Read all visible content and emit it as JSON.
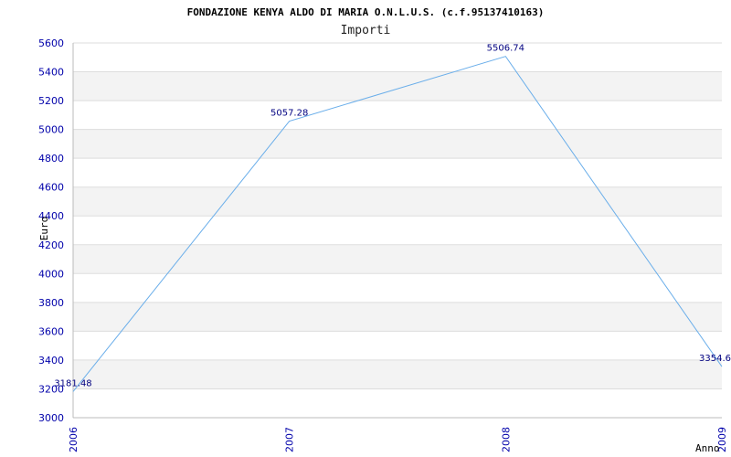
{
  "colors": {
    "line": "#6aaeea",
    "tick_text": "#0000aa",
    "data_label": "#000080",
    "band": "#f3f3f3",
    "grid": "#dddddd",
    "axis": "#bbbbbb"
  },
  "chart_data": {
    "type": "line",
    "title": "FONDAZIONE KENYA ALDO DI MARIA O.N.L.U.S. (c.f.95137410163)",
    "subtitle": "Importi",
    "xlabel": "Anno",
    "ylabel": "Euro",
    "categories": [
      "2006",
      "2007",
      "2008",
      "2009"
    ],
    "series": [
      {
        "values": [
          3181.48,
          5057.28,
          5506.74,
          3354.6
        ],
        "labels": [
          "3181.48",
          "5057.28",
          "5506.74",
          "3354.6"
        ]
      }
    ],
    "ylim": [
      3000,
      5600
    ],
    "yticks": [
      3000,
      3200,
      3400,
      3600,
      3800,
      4000,
      4200,
      4400,
      4600,
      4800,
      5000,
      5200,
      5400,
      5600
    ],
    "grid": true,
    "legend": "none"
  }
}
